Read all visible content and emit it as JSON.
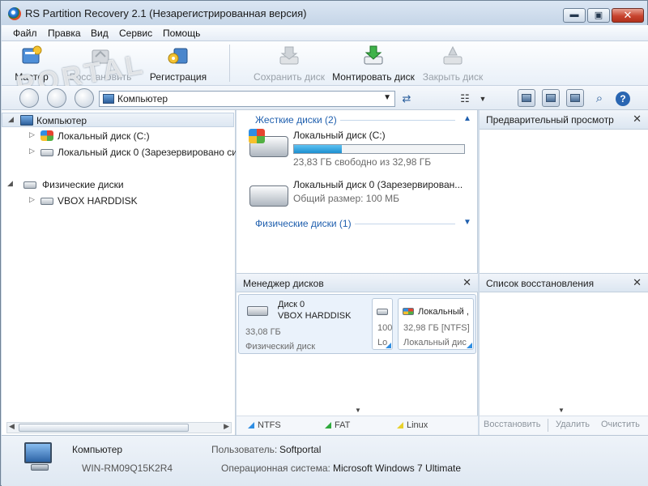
{
  "window": {
    "title": "RS Partition Recovery 2.1 (Незарегистрированная версия)",
    "minimize_glyph": "▬",
    "maximize_glyph": "▣",
    "close_glyph": "✕"
  },
  "menu": [
    "Файл",
    "Правка",
    "Вид",
    "Сервис",
    "Помощь"
  ],
  "watermark": "PORTAL",
  "toolbar": {
    "master": "Мастер",
    "restore": "Восстановить",
    "register": "Регистрация",
    "save_disk": "Сохранить диск",
    "mount_disk": "Монтировать диск",
    "close_disk": "Закрыть диск"
  },
  "address": {
    "value": "Компьютер",
    "dropdown_glyph": "▼",
    "search_glyph": "⌕",
    "help_glyph": "?"
  },
  "tree": {
    "computer": "Компьютер",
    "local_c": "Локальный диск (C:)",
    "local_0": "Локальный диск 0 (Зарезервировано си",
    "physical": "Физические диски",
    "vbox": "VBOX HARDDISK"
  },
  "disks": {
    "hard_group": "Жесткие диски (2)",
    "physical_group": "Физические диски (1)",
    "c_name": "Локальный диск (C:)",
    "c_free": "23,83 ГБ свободно из 32,98 ГБ",
    "c_used_fraction": 0.28,
    "d0_name": "Локальный диск 0 (Зарезервирован...",
    "d0_size": "Общий размер: 100 МБ"
  },
  "preview": {
    "title": "Предварительный просмотр"
  },
  "disk_manager": {
    "title": "Менеджер дисков",
    "disk_label": "Диск 0",
    "disk_model": "VBOX HARDDISK",
    "disk_size": "33,08 ГБ",
    "disk_type": "Физический диск",
    "part1_size": "100",
    "part1_type": "Lo",
    "part2_name": "Локальный ,",
    "part2_size": "32,98 ГБ [NTFS]",
    "part2_type": "Локальный дис"
  },
  "legend": {
    "ntfs": "NTFS",
    "fat": "FAT",
    "linux": "Linux",
    "colors": {
      "ntfs": "#2f8ee3",
      "fat": "#2faa3d",
      "linux": "#e8d12c"
    }
  },
  "restore_list": {
    "title": "Список восстановления",
    "restore": "Восстановить",
    "delete": "Удалить",
    "clear": "Очистить"
  },
  "status": {
    "computer_label": "Компьютер",
    "computer_name": "WIN-RM09Q15K2R4",
    "user_label": "Пользователь:",
    "user_value": "Softportal",
    "os_label": "Операционная система:",
    "os_value": "Microsoft Windows 7 Ultimate"
  }
}
